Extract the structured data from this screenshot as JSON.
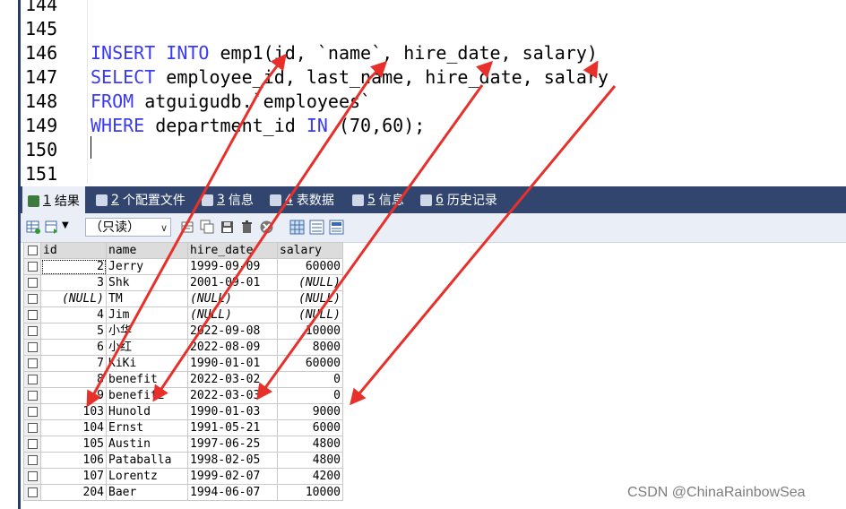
{
  "editor": {
    "lines": [
      {
        "num": "144",
        "tokens": []
      },
      {
        "num": "145",
        "tokens": []
      },
      {
        "num": "146",
        "tokens": [
          {
            "t": "INSERT INTO",
            "kw": true
          },
          {
            "t": " emp1(id, `name`, hire_date, salary)",
            "kw": false
          }
        ]
      },
      {
        "num": "147",
        "tokens": [
          {
            "t": "SELECT",
            "kw": true
          },
          {
            "t": " employee_id, last_name, hire_date, salary",
            "kw": false
          }
        ]
      },
      {
        "num": "148",
        "tokens": [
          {
            "t": "FROM",
            "kw": true
          },
          {
            "t": " atguigudb.`employees`",
            "kw": false
          }
        ]
      },
      {
        "num": "149",
        "tokens": [
          {
            "t": "WHERE",
            "kw": true
          },
          {
            "t": " department_id ",
            "kw": false
          },
          {
            "t": "IN",
            "kw": true
          },
          {
            "t": " (70,60);",
            "kw": false
          }
        ]
      },
      {
        "num": "150",
        "tokens": []
      },
      {
        "num": "151",
        "tokens": []
      }
    ]
  },
  "tabs": [
    {
      "num": "1",
      "label": "结果",
      "active": true,
      "icon": "result-grid-icon"
    },
    {
      "num": "2",
      "label": "个配置文件",
      "active": false,
      "icon": "profile-icon"
    },
    {
      "num": "3",
      "label": "信息",
      "active": false,
      "icon": "info-icon"
    },
    {
      "num": "4",
      "label": "表数据",
      "active": false,
      "icon": "table-data-icon"
    },
    {
      "num": "5",
      "label": "信息",
      "active": false,
      "icon": "info-colored-icon"
    },
    {
      "num": "6",
      "label": "历史记录",
      "active": false,
      "icon": "history-icon"
    }
  ],
  "toolbar": {
    "readonly_select": "（只读）"
  },
  "grid": {
    "columns": [
      "id",
      "name",
      "hire_date",
      "salary"
    ],
    "rows": [
      [
        "2",
        "Jerry",
        "1999-09-09",
        "60000"
      ],
      [
        "3",
        "Shk",
        "2001-09-01",
        "(NULL)"
      ],
      [
        "(NULL)",
        "TM",
        "(NULL)",
        "(NULL)"
      ],
      [
        "4",
        "Jim",
        "(NULL)",
        "(NULL)"
      ],
      [
        "5",
        "小华",
        "2022-09-08",
        "10000"
      ],
      [
        "6",
        "小红",
        "2022-08-09",
        "8000"
      ],
      [
        "7",
        "KiKi",
        "1990-01-01",
        "60000"
      ],
      [
        "8",
        "benefit",
        "2022-03-02",
        "0"
      ],
      [
        "9",
        "benefit2",
        "2022-03-03",
        "0"
      ],
      [
        "103",
        "Hunold",
        "1990-01-03",
        "9000"
      ],
      [
        "104",
        "Ernst",
        "1991-05-21",
        "6000"
      ],
      [
        "105",
        "Austin",
        "1997-06-25",
        "4800"
      ],
      [
        "106",
        "Pataballa",
        "1998-02-05",
        "4800"
      ],
      [
        "107",
        "Lorentz",
        "1999-02-07",
        "4200"
      ],
      [
        "204",
        "Baer",
        "1994-06-07",
        "10000"
      ]
    ]
  },
  "watermark": "CSDN @ChinaRainbowSea",
  "colors": {
    "keyword": "#3a3af0",
    "arrow": "#e8302a",
    "tabbar": "#31456e"
  }
}
